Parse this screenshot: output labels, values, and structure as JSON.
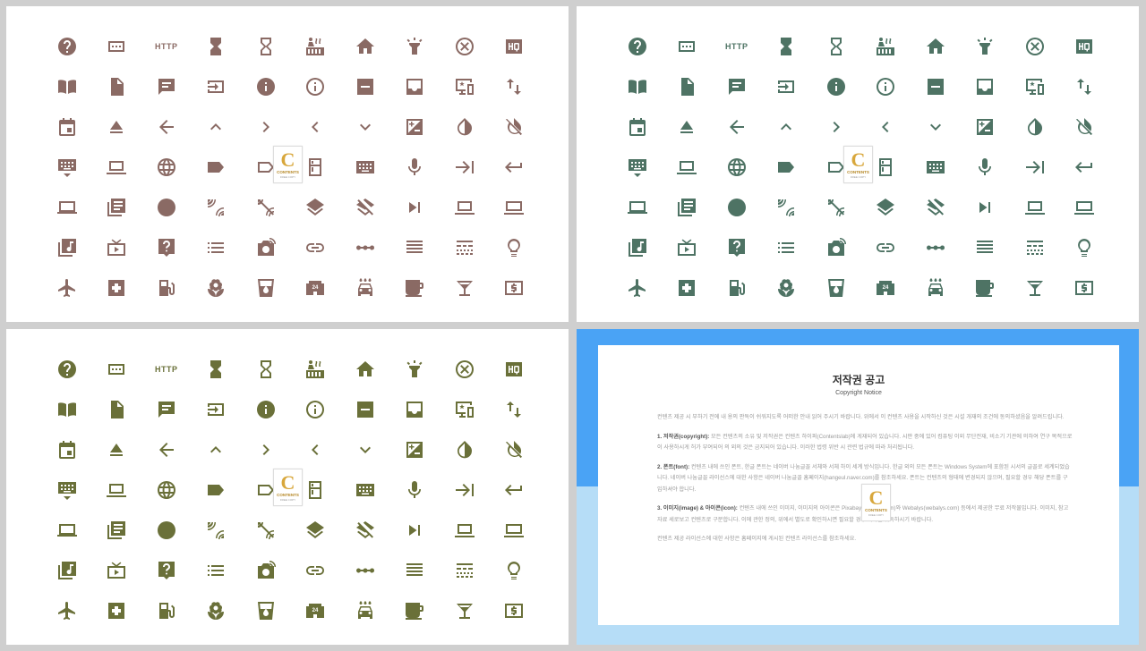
{
  "panels": [
    {
      "name": "icon-sheet-brown",
      "color": "#8a6a64"
    },
    {
      "name": "icon-sheet-green",
      "color": "#4e7364"
    },
    {
      "name": "icon-sheet-olive",
      "color": "#6a7039"
    }
  ],
  "icons": [
    "help-icon",
    "keyboard-alt-icon",
    "http-text",
    "hourglass-full-icon",
    "hourglass-empty-icon",
    "hot-tub-icon",
    "home-icon",
    "highlight-icon",
    "cancel-icon",
    "hq-icon",
    "book-icon",
    "file-icon",
    "chat-icon",
    "input-icon",
    "info-icon",
    "info-outline-icon",
    "remove-box-icon",
    "inbox-icon",
    "important-devices-icon",
    "import-export-icon",
    "event-icon",
    "eject-icon",
    "arrow-back-icon",
    "chevron-up-icon",
    "chevron-right-icon",
    "chevron-left-icon",
    "chevron-down-icon",
    "exposure-icon",
    "invert-colors-icon",
    "invert-colors-off-icon",
    "keyboard-hide-icon",
    "laptop-icon",
    "language-icon",
    "label-icon",
    "label-outline-icon",
    "kitchen-icon",
    "keyboard-icon",
    "mic-icon",
    "arrow-to-right-icon",
    "keyboard-return-icon",
    "laptop-windows-icon",
    "library-books-icon",
    "circle-icon",
    "leak-add-icon",
    "leak-remove-icon",
    "layers-icon",
    "layers-clear-icon",
    "skip-next-icon",
    "laptop-outline-icon",
    "laptop-alt-icon",
    "library-music-icon",
    "live-tv-icon",
    "live-help-icon",
    "list-icon",
    "linked-camera-icon",
    "link-icon",
    "linear-scale-icon",
    "reorder-icon",
    "line-style-icon",
    "lightbulb-icon",
    "flight-icon",
    "local-hospital-icon",
    "gas-station-icon",
    "florist-icon",
    "drink-icon",
    "convenience-store-icon",
    "car-wash-icon",
    "cafe-icon",
    "bar-icon",
    "atm-icon"
  ],
  "http_label": "HTTP",
  "logo": {
    "letter": "C",
    "line1": "CONTENTS",
    "line2": "FREE COPY"
  },
  "notice": {
    "title": "저작권 공고",
    "subtitle": "Copyright Notice",
    "p1": "컨텐츠 제공 시 부하기 전에 내 용의 판독이 쉬워지도록 어떠한 안내 읽어 주시기 바랍니다. 위에서 이 컨텐츠 사용을 시작하신 것은 시설 개재의 조건에 동의하셨음을 알려드립니다.",
    "p2_head": "1. 저작권(copyright):",
    "p2": " 모든 컨텐츠의 소유 및 저작권은 컨텐츠 하이퍼(Contentslab)에 게재되어 있습니다. 시판 중에 있어 컴퓨팅 이외 무단전재, 비소기 기관에 의하여 연구 목적으로 이 사용하시게 허가 부여되어 의 외의 것은 금지되어 있습니다. 이러한 법령 위반 시 관련 법규에 따라 처리됩니다.",
    "p3_head": "2. 폰트(font):",
    "p3": " 컨텐츠 내에 쓰인 폰트, 한글 폰트는 네이버 나눔글꼴 서체와 서체 하이 세계 방식입니다. 한글 외의 모든 폰트는 Windows System에 포함된 시서의 글꼴로 세계되었습니다. 네이버 나눔글꼴 라이선스에 대한 사항은 네이버 나눔글꼴 홈페이지(hangeul.naver.com)를 참조하세요. 폰트는 컨텐츠의 형태에 변경되지 않으며, 필요할 경우 해당 폰트를 구입하셔야 합니다.",
    "p4_head": "3. 이미지(image) & 아이콘(icon):",
    "p4": " 컨텐츠 내에 쓰인 이미지, 이미지의 아이콘은 Pixabay(pixabay.com)와 Webalys(webalys.com) 등에서 제공한 무료 저작물입니다. 이미지, 참고자료 세로보고 컨텐츠로 구분합니다. 이에 관한 정의, 위에서 별도로 확인하시면 필요할 경우 허가를 취득하시기 바랍니다.",
    "p5": "컨텐츠 제공 라이선스에 대한 사항은 홈페이지에 게시된 컨텐츠 라이선스를 참조하세요."
  }
}
